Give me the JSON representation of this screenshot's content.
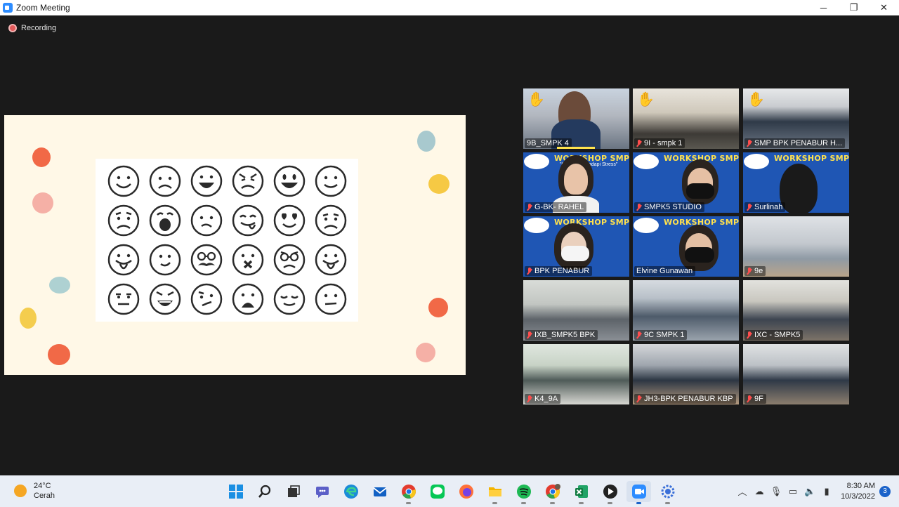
{
  "window": {
    "title": "Zoom Meeting",
    "minimize": "─",
    "maximize": "❐",
    "close": "✕"
  },
  "recording": {
    "label": "Recording"
  },
  "gallery": {
    "tiles": [
      {
        "name": "9B_SMPK 4",
        "hand": "✋",
        "muted": false
      },
      {
        "name": "9I - smpk 1",
        "hand": "✋",
        "muted": true
      },
      {
        "name": "SMP BPK PENABUR H...",
        "hand": "✋",
        "muted": true
      },
      {
        "name": "G-BK- RAHEL",
        "muted": true
      },
      {
        "name": "SMPK5 STUDIO",
        "muted": true
      },
      {
        "name": "Surlinah",
        "muted": true
      },
      {
        "name": "BPK PENABUR",
        "muted": true
      },
      {
        "name": "Elvine Gunawan",
        "muted": false
      },
      {
        "name": "9e",
        "muted": true
      },
      {
        "name": "IXB_SMPK5 BPK",
        "muted": true
      },
      {
        "name": "9C SMPK 1",
        "muted": true
      },
      {
        "name": "IXC - SMPK5",
        "muted": true
      },
      {
        "name": "K4_9A",
        "muted": true
      },
      {
        "name": "JH3-BPK PENABUR KBP",
        "muted": true
      },
      {
        "name": "9F",
        "muted": true
      }
    ],
    "banner": {
      "title": "WORKSHOP SMP",
      "subtitle": "\"Cara Menghadapi Stress\""
    }
  },
  "taskbar": {
    "weather": {
      "temp": "24°C",
      "condition": "Cerah"
    },
    "apps": [
      "windows-start",
      "search",
      "task-view",
      "teams-chat",
      "edge",
      "mail",
      "chrome",
      "line",
      "firefox",
      "file-explorer",
      "spotify",
      "chrome-profile",
      "excel",
      "media-player",
      "zoom",
      "bluetooth-settings"
    ],
    "clock": {
      "time": "8:30 AM",
      "date": "10/3/2022"
    },
    "notifications": "3"
  },
  "colors": {
    "accent": "#2d8cff",
    "recording": "#e35a5a",
    "active_speaker": "#e7e76a",
    "muted": "#ff4d4d"
  }
}
